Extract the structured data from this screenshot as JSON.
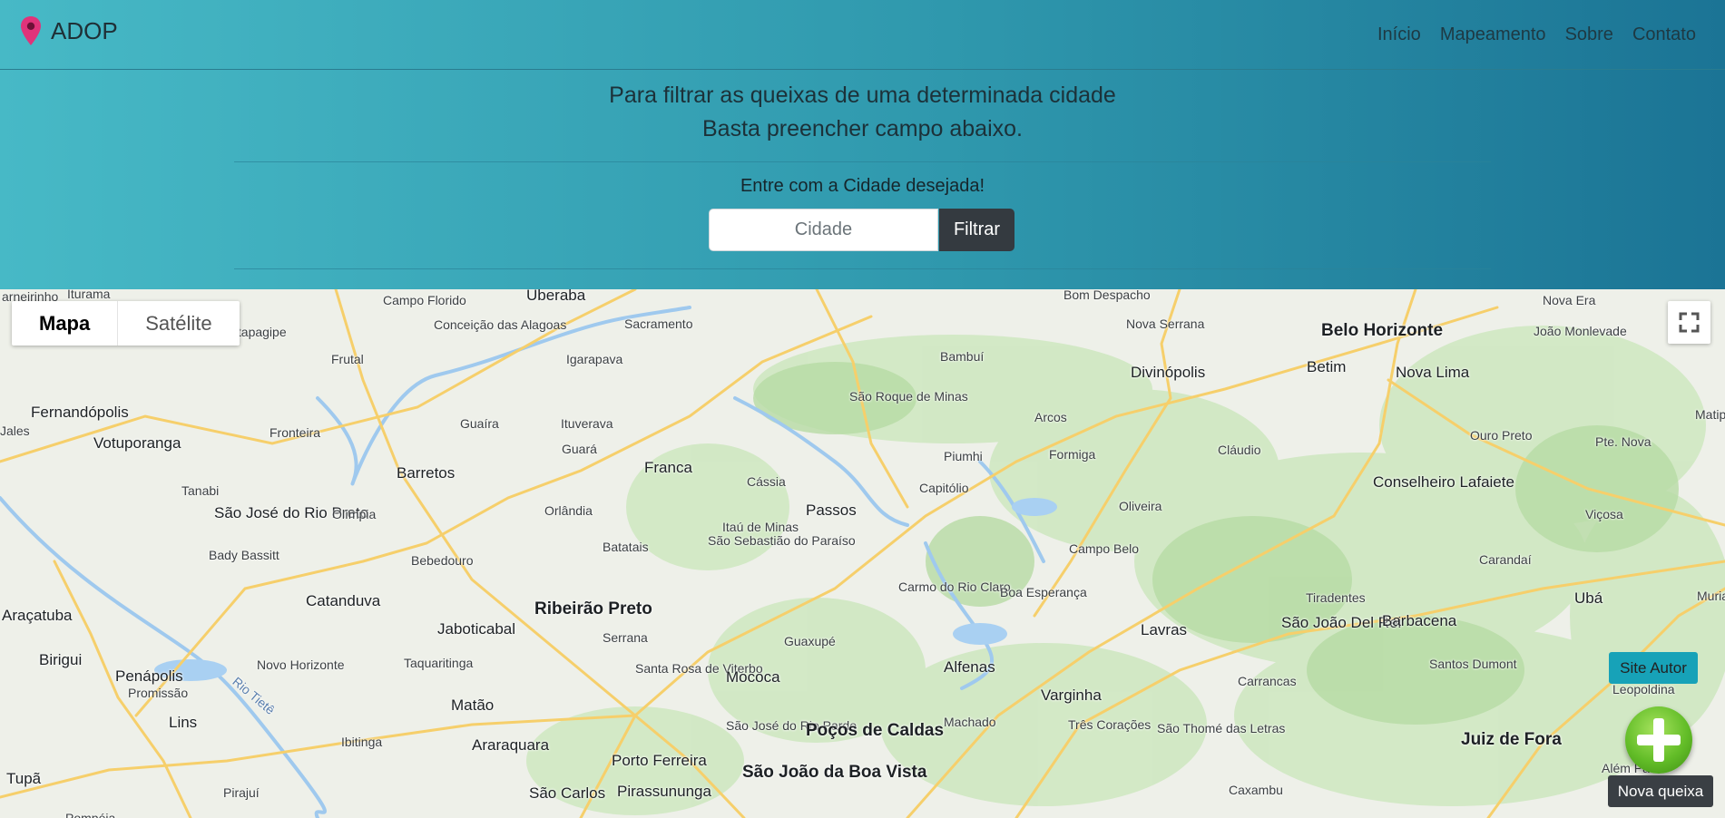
{
  "navbar": {
    "brand": "ADOP",
    "links": [
      "Início",
      "Mapeamento",
      "Sobre",
      "Contato"
    ]
  },
  "intro": {
    "line1": "Para filtrar as queixas de uma determinada cidade",
    "line2": "Basta preencher campo abaixo."
  },
  "filter": {
    "label": "Entre com a Cidade desejada!",
    "placeholder": "Cidade",
    "button": "Filtrar"
  },
  "map": {
    "types": [
      "Mapa",
      "Satélite"
    ],
    "active_type": "Mapa",
    "places": [
      "arneirinho",
      "Iturama",
      "Campo Florido",
      "Uberaba",
      "Sacramento",
      "Bom Despacho",
      "Nova Serrana",
      "Belo Horizonte",
      "Nova Era",
      "João Monlevade",
      "Itapagipe",
      "Conceição das Alagoas",
      "Frutal",
      "Igarapava",
      "Bambuí",
      "Divinópolis",
      "Betim",
      "Nova Lima",
      "São Roque de Minas",
      "Fernandópolis",
      "Jales",
      "Votuporanga",
      "Fronteira",
      "Guaíra",
      "Ituverava",
      "Guará",
      "Arcos",
      "Ouro Preto",
      "Pte. Nova",
      "Piumhi",
      "Formiga",
      "Cláudio",
      "Barretos",
      "Franca",
      "Cássia",
      "Capitólio",
      "Oliveira",
      "Conselheiro Lafaiete",
      "Tanabi",
      "São José do Rio Preto",
      "Olímpia",
      "Orlândia",
      "Passos",
      "Viçosa",
      "Itaú de Minas",
      "São Sebastião do Paraíso",
      "Bady Bassitt",
      "Bebedouro",
      "Batatais",
      "Campo Belo",
      "Carandaí",
      "Carmo do Rio Claro",
      "Boa Esperança",
      "Araçatuba",
      "Catanduva",
      "Jaboticabal",
      "Ribeirão Preto",
      "Lavras",
      "São João Del Rei",
      "Tiradentes",
      "Barbacena",
      "Ubá",
      "Serrana",
      "Guaxupé",
      "Alfenas",
      "Birigui",
      "Penápolis",
      "Novo Horizonte",
      "Taquaritinga",
      "Santa Rosa de Viterbo",
      "Mococa",
      "Varginha",
      "Carrancas",
      "Santos Dumont",
      "Leopoldina",
      "Promissão",
      "Matão",
      "Lins",
      "Ibitinga",
      "Araraquara",
      "São José do Rio Pardo",
      "Poços de Caldas",
      "Machado",
      "Três Corações",
      "São Thomé das Letras",
      "Juiz de Fora",
      "Tupã",
      "Porto Ferreira",
      "São João da Boa Vista",
      "Pirajuí",
      "São Carlos",
      "Pirassununga",
      "Caxambu",
      "Além Pa",
      "Matip",
      "Muriae",
      "Pompéia",
      "Rio Tietê"
    ]
  },
  "buttons": {
    "site_autor": "Site Autor",
    "nova_queixa": "Nova queixa"
  }
}
